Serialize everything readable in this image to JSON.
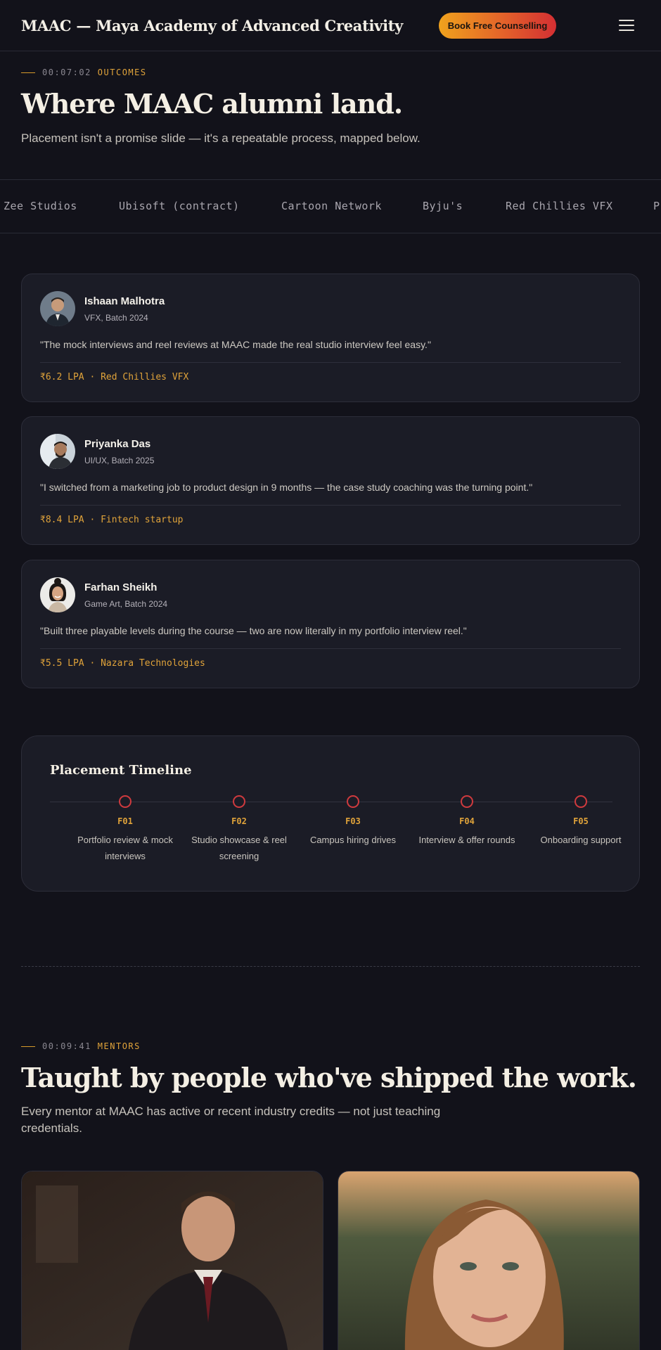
{
  "header": {
    "logo_text": "MAAC — Maya Academy of Advanced Creativity",
    "cta_label": "Book Free Counselling",
    "menu_icon": "hamburger-icon"
  },
  "outcomes": {
    "timestamp": "00:07:02",
    "tag": "OUTCOMES",
    "title": "Where MAAC alumni land.",
    "subtitle": "Placement isn't a promise slide — it's a repeatable process, mapped below."
  },
  "studios": [
    "Zee Studios",
    "Ubisoft (contract)",
    "Cartoon Network",
    "Byju's",
    "Red Chillies VFX",
    "P"
  ],
  "testimonials": [
    {
      "name": "Ishaan Malhotra",
      "role": "VFX, Batch 2024",
      "quote": "\"The mock interviews and reel reviews at MAAC made the real studio interview feel easy.\"",
      "result": "₹6.2 LPA · Red Chillies VFX"
    },
    {
      "name": "Priyanka Das",
      "role": "UI/UX, Batch 2025",
      "quote": "\"I switched from a marketing job to product design in 9 months — the case study coaching was the turning point.\"",
      "result": "₹8.4 LPA · Fintech startup"
    },
    {
      "name": "Farhan Sheikh",
      "role": "Game Art, Batch 2024",
      "quote": "\"Built three playable levels during the course — two are now literally in my portfolio interview reel.\"",
      "result": "₹5.5 LPA · Nazara Technologies"
    }
  ],
  "timeline": {
    "title": "Placement Timeline",
    "steps": [
      {
        "code": "F01",
        "label": "Portfolio review & mock interviews"
      },
      {
        "code": "F02",
        "label": "Studio showcase & reel screening"
      },
      {
        "code": "F03",
        "label": "Campus hiring drives"
      },
      {
        "code": "F04",
        "label": "Interview & offer rounds"
      },
      {
        "code": "F05",
        "label": "Onboarding support"
      }
    ]
  },
  "mentors": {
    "timestamp": "00:09:41",
    "tag": "MENTORS",
    "title": "Taught by people who've shipped the work.",
    "subtitle": "Every mentor at MAAC has active or recent industry credits — not just teaching credentials."
  },
  "colors": {
    "background": "#12121a",
    "card": "#1b1c26",
    "accent_gold": "#e0a33a",
    "accent_red": "#cf3a3e"
  }
}
